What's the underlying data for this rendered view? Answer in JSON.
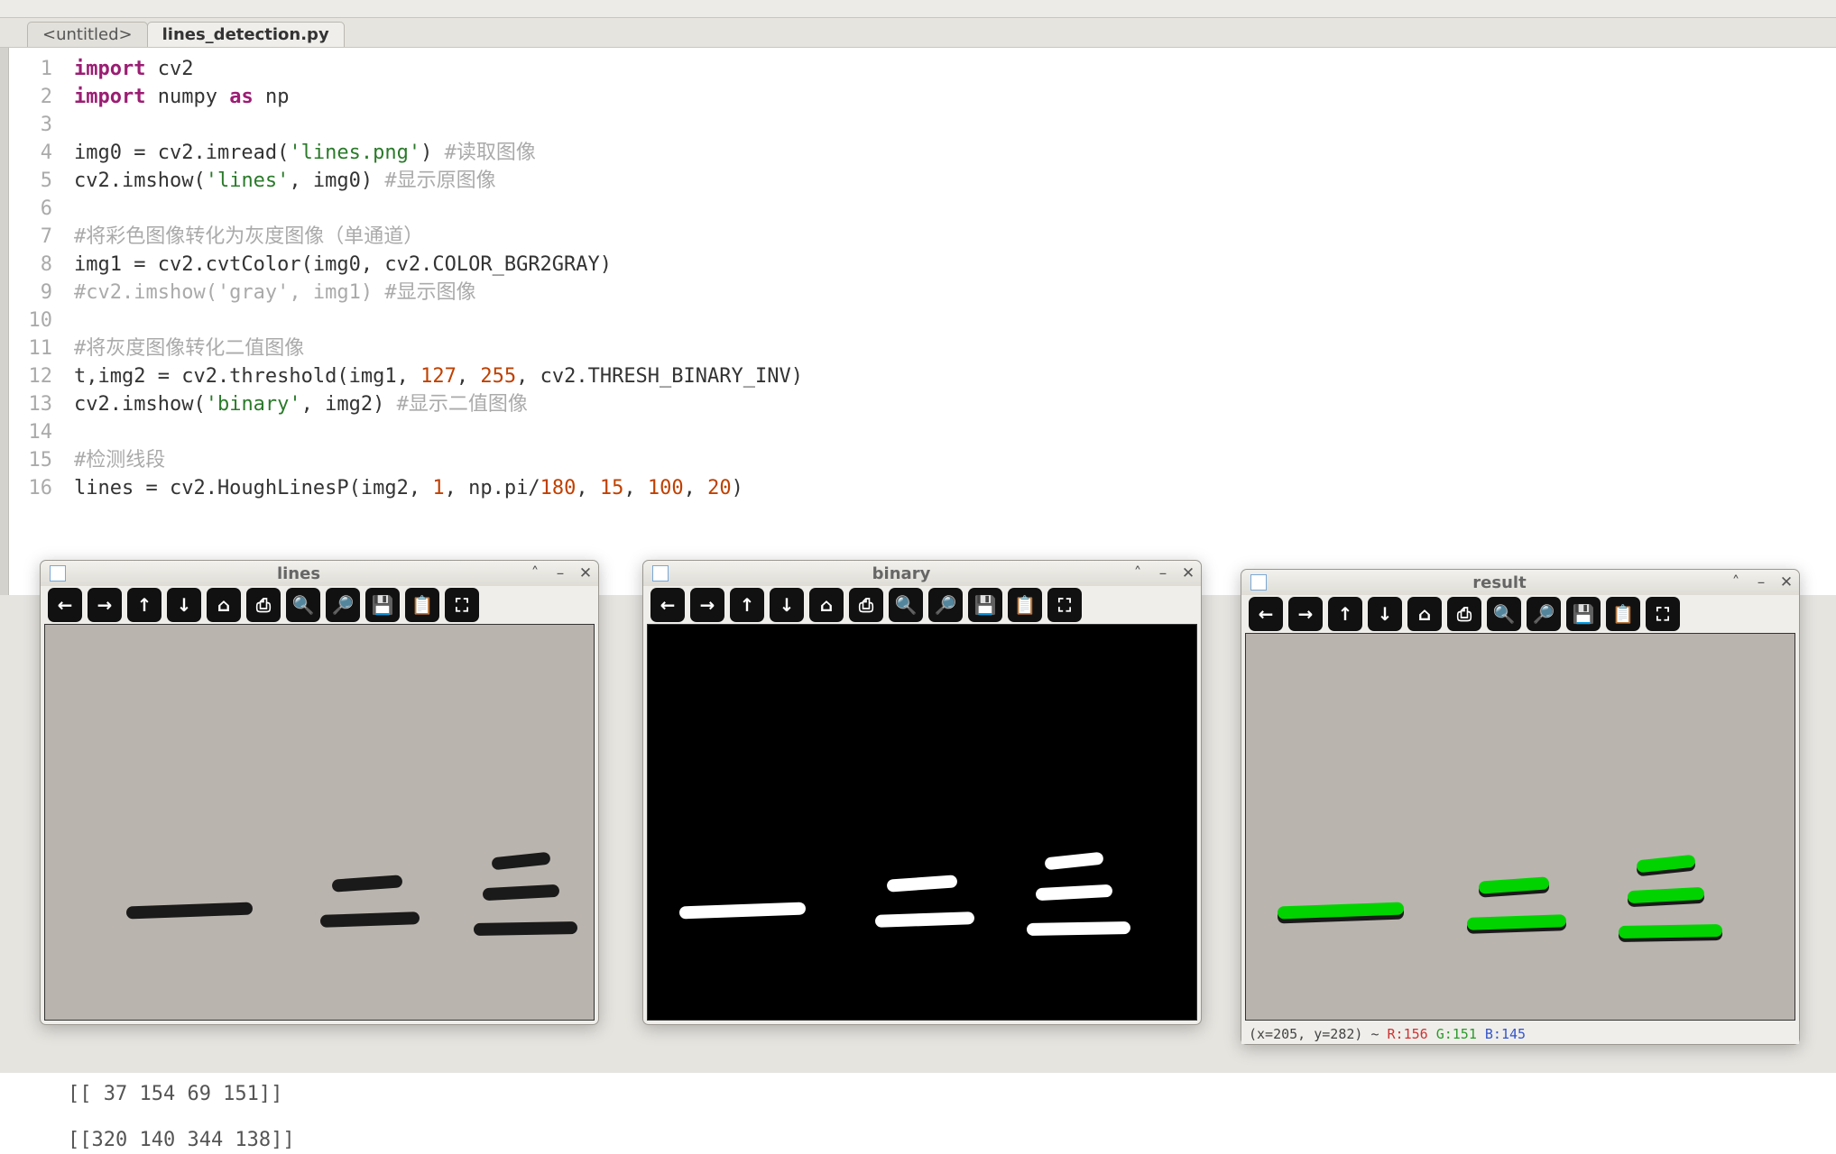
{
  "tabs": {
    "untitled": "<untitled>",
    "file": "lines_detection.py"
  },
  "code": {
    "l1": "import cv2",
    "l2": "import numpy as np",
    "l3": "",
    "l4": "img0 = cv2.imread('lines.png') #读取图像",
    "l5": "cv2.imshow('lines', img0) #显示原图像",
    "l6": "",
    "l7": "#将彩色图像转化为灰度图像（单通道）",
    "l8": "img1 = cv2.cvtColor(img0, cv2.COLOR_BGR2GRAY)",
    "l9": "#cv2.imshow('gray', img1) #显示图像",
    "l10": "",
    "l11": "#将灰度图像转化二值图像",
    "l12": "t,img2 = cv2.threshold(img1, 127, 255, cv2.THRESH_BINARY_INV)",
    "l13": "cv2.imshow('binary', img2) #显示二值图像",
    "l14": "",
    "l15": "#检测线段",
    "l16": "lines = cv2.HoughLinesP(img2, 1, np.pi/180, 15, 100, 20)"
  },
  "line_numbers": [
    "1",
    "2",
    "3",
    "4",
    "5",
    "6",
    "7",
    "8",
    "9",
    "10",
    "11",
    "12",
    "13",
    "14",
    "15",
    "16"
  ],
  "output": {
    "line1": "[[ 37 154  69 151]]",
    "line2": "[[320 140 344 138]]"
  },
  "behind_text": ".), ",
  "windows": {
    "lines": {
      "title": "lines"
    },
    "binary": {
      "title": "binary"
    },
    "result": {
      "title": "result",
      "status_prefix": "(x=205, y=282) ~ ",
      "r": "R:156",
      "g": "G:151",
      "b": "B:145"
    }
  },
  "cv_tools": [
    "←",
    "→",
    "↑",
    "↓",
    "⌂",
    "⎙",
    "🔍",
    "🔎",
    "💾",
    "📋",
    "⛶"
  ]
}
